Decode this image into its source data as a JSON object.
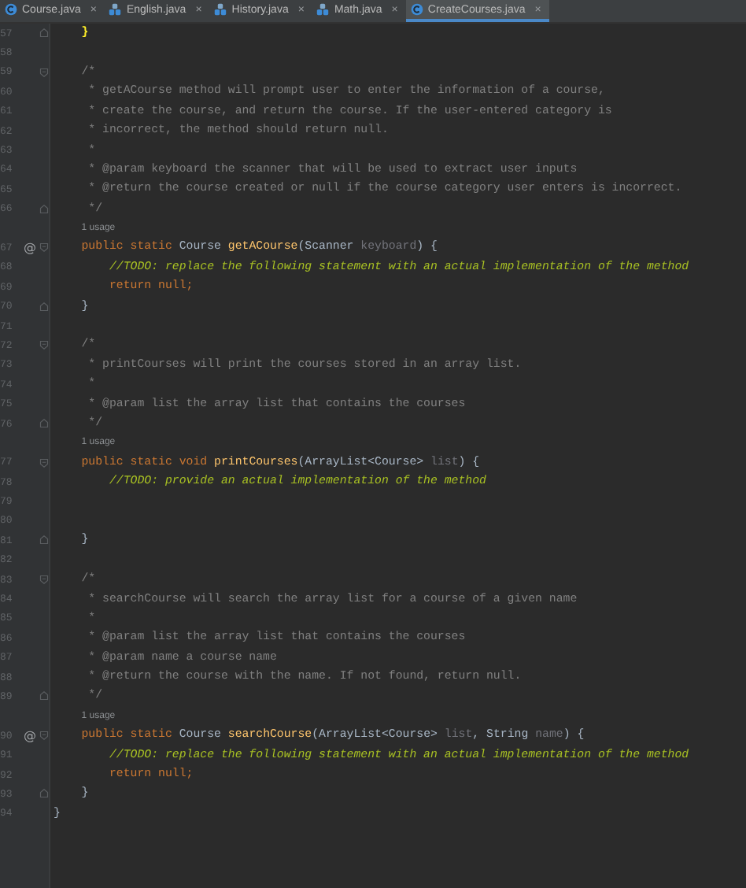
{
  "tabs": [
    {
      "label": "Course.java",
      "kind": "class",
      "close": "×",
      "selected": false
    },
    {
      "label": "English.java",
      "kind": "subclass",
      "close": "×",
      "selected": false
    },
    {
      "label": "History.java",
      "kind": "subclass",
      "close": "×",
      "selected": false
    },
    {
      "label": "Math.java",
      "kind": "subclass",
      "close": "×",
      "selected": false
    },
    {
      "label": "CreateCourses.java",
      "kind": "class",
      "close": "×",
      "selected": true
    }
  ],
  "editor": {
    "rows": [
      {
        "kind": "code",
        "number": "57",
        "fold": {
          "kind": "close"
        },
        "tokens": [
          {
            "kind": "match",
            "text": "    }"
          }
        ]
      },
      {
        "kind": "code",
        "number": "58",
        "tokens": []
      },
      {
        "kind": "code",
        "number": "59",
        "fold": {
          "kind": "open"
        },
        "tokens": [
          {
            "kind": "comment",
            "text": "    /*"
          }
        ]
      },
      {
        "kind": "code",
        "number": "60",
        "tokens": [
          {
            "kind": "comment",
            "text": "     * getACourse method will prompt user to enter the information of a course,"
          }
        ]
      },
      {
        "kind": "code",
        "number": "61",
        "tokens": [
          {
            "kind": "comment",
            "text": "     * create the course, and return the course. If the user-entered category is"
          }
        ]
      },
      {
        "kind": "code",
        "number": "62",
        "tokens": [
          {
            "kind": "comment",
            "text": "     * incorrect, the method should return null."
          }
        ]
      },
      {
        "kind": "code",
        "number": "63",
        "tokens": [
          {
            "kind": "comment",
            "text": "     *"
          }
        ]
      },
      {
        "kind": "code",
        "number": "64",
        "tokens": [
          {
            "kind": "comment",
            "text": "     * @param keyboard the scanner that will be used to extract user inputs"
          }
        ]
      },
      {
        "kind": "code",
        "number": "65",
        "tokens": [
          {
            "kind": "comment",
            "text": "     * @return the course created or null if the course category user enters is incorrect."
          }
        ]
      },
      {
        "kind": "code",
        "number": "66",
        "fold": {
          "kind": "close"
        },
        "tokens": [
          {
            "kind": "comment",
            "text": "     */"
          }
        ]
      },
      {
        "kind": "usage",
        "text": "1 usage"
      },
      {
        "kind": "code",
        "number": "67",
        "mark": "@",
        "fold": {
          "kind": "open"
        },
        "tokens": [
          {
            "kind": "keyword",
            "text": "    public static "
          },
          {
            "kind": "plain",
            "text": "Course "
          },
          {
            "kind": "method",
            "text": "getACourse"
          },
          {
            "kind": "plain",
            "text": "(Scanner "
          },
          {
            "kind": "param",
            "text": "keyboard"
          },
          {
            "kind": "plain",
            "text": ") {"
          }
        ]
      },
      {
        "kind": "code",
        "number": "68",
        "tokens": [
          {
            "kind": "todo",
            "text": "        //TODO: replace the following statement with an actual implementation of the method"
          }
        ]
      },
      {
        "kind": "code",
        "number": "69",
        "tokens": [
          {
            "kind": "keyword",
            "text": "        return null;"
          }
        ]
      },
      {
        "kind": "code",
        "number": "70",
        "fold": {
          "kind": "close"
        },
        "tokens": [
          {
            "kind": "plain",
            "text": "    }"
          }
        ]
      },
      {
        "kind": "code",
        "number": "71",
        "tokens": []
      },
      {
        "kind": "code",
        "number": "72",
        "fold": {
          "kind": "open"
        },
        "tokens": [
          {
            "kind": "comment",
            "text": "    /*"
          }
        ]
      },
      {
        "kind": "code",
        "number": "73",
        "tokens": [
          {
            "kind": "comment",
            "text": "     * printCourses will print the courses stored in an array list."
          }
        ]
      },
      {
        "kind": "code",
        "number": "74",
        "tokens": [
          {
            "kind": "comment",
            "text": "     *"
          }
        ]
      },
      {
        "kind": "code",
        "number": "75",
        "tokens": [
          {
            "kind": "comment",
            "text": "     * @param list the array list that contains the courses"
          }
        ]
      },
      {
        "kind": "code",
        "number": "76",
        "fold": {
          "kind": "close"
        },
        "tokens": [
          {
            "kind": "comment",
            "text": "     */"
          }
        ]
      },
      {
        "kind": "usage",
        "text": "1 usage"
      },
      {
        "kind": "code",
        "number": "77",
        "fold": {
          "kind": "open"
        },
        "tokens": [
          {
            "kind": "keyword",
            "text": "    public static void "
          },
          {
            "kind": "method",
            "text": "printCourses"
          },
          {
            "kind": "plain",
            "text": "(ArrayList<Course> "
          },
          {
            "kind": "param",
            "text": "list"
          },
          {
            "kind": "plain",
            "text": ") {"
          }
        ]
      },
      {
        "kind": "code",
        "number": "78",
        "tokens": [
          {
            "kind": "todo",
            "text": "        //TODO: provide an actual implementation of the method"
          }
        ]
      },
      {
        "kind": "code",
        "number": "79",
        "tokens": []
      },
      {
        "kind": "code",
        "number": "80",
        "tokens": []
      },
      {
        "kind": "code",
        "number": "81",
        "fold": {
          "kind": "close"
        },
        "tokens": [
          {
            "kind": "plain",
            "text": "    }"
          }
        ]
      },
      {
        "kind": "code",
        "number": "82",
        "tokens": []
      },
      {
        "kind": "code",
        "number": "83",
        "fold": {
          "kind": "open"
        },
        "tokens": [
          {
            "kind": "comment",
            "text": "    /*"
          }
        ]
      },
      {
        "kind": "code",
        "number": "84",
        "tokens": [
          {
            "kind": "comment",
            "text": "     * searchCourse will search the array list for a course of a given name"
          }
        ]
      },
      {
        "kind": "code",
        "number": "85",
        "tokens": [
          {
            "kind": "comment",
            "text": "     *"
          }
        ]
      },
      {
        "kind": "code",
        "number": "86",
        "tokens": [
          {
            "kind": "comment",
            "text": "     * @param list the array list that contains the courses"
          }
        ]
      },
      {
        "kind": "code",
        "number": "87",
        "tokens": [
          {
            "kind": "comment",
            "text": "     * @param name a course name"
          }
        ]
      },
      {
        "kind": "code",
        "number": "88",
        "tokens": [
          {
            "kind": "comment",
            "text": "     * @return the course with the name. If not found, return null."
          }
        ]
      },
      {
        "kind": "code",
        "number": "89",
        "fold": {
          "kind": "close"
        },
        "tokens": [
          {
            "kind": "comment",
            "text": "     */"
          }
        ]
      },
      {
        "kind": "usage",
        "text": "1 usage"
      },
      {
        "kind": "code",
        "number": "90",
        "mark": "@",
        "fold": {
          "kind": "open"
        },
        "tokens": [
          {
            "kind": "keyword",
            "text": "    public static "
          },
          {
            "kind": "plain",
            "text": "Course "
          },
          {
            "kind": "method",
            "text": "searchCourse"
          },
          {
            "kind": "plain",
            "text": "(ArrayList<Course> "
          },
          {
            "kind": "param",
            "text": "list"
          },
          {
            "kind": "plain",
            "text": ", String "
          },
          {
            "kind": "param",
            "text": "name"
          },
          {
            "kind": "plain",
            "text": ") {"
          }
        ]
      },
      {
        "kind": "code",
        "number": "91",
        "tokens": [
          {
            "kind": "todo",
            "text": "        //TODO: replace the following statement with an actual implementation of the method"
          }
        ]
      },
      {
        "kind": "code",
        "number": "92",
        "tokens": [
          {
            "kind": "keyword",
            "text": "        return null;"
          }
        ]
      },
      {
        "kind": "code",
        "number": "93",
        "fold": {
          "kind": "close"
        },
        "tokens": [
          {
            "kind": "plain",
            "text": "    }"
          }
        ]
      },
      {
        "kind": "code",
        "number": "94",
        "tokens": [
          {
            "kind": "plain",
            "text": "}"
          }
        ]
      }
    ]
  }
}
